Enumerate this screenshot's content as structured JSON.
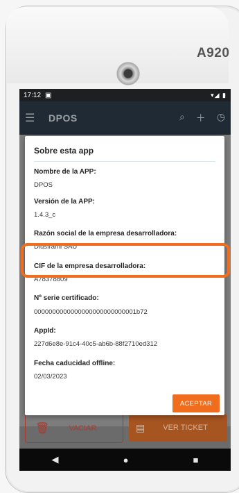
{
  "device": {
    "model": "A920"
  },
  "status_bar": {
    "time": "17:12",
    "icons": "▾◢ ▮"
  },
  "app_bar": {
    "title": "DPOS"
  },
  "dialog": {
    "title": "Sobre esta app",
    "fields": [
      {
        "label": "Nombre de la APP:",
        "value": "DPOS"
      },
      {
        "label": "Versión de la APP:",
        "value": "1.4.3_c"
      },
      {
        "label": "Razón social de la empresa desarrolladora:",
        "value": "Diusframi SAU"
      },
      {
        "label": "CIF de la empresa desarrolladora:",
        "value": "A78378809"
      },
      {
        "label": "Nº serie certificado:",
        "value": "0000000000000000000000000001b72"
      },
      {
        "label": "AppId:",
        "value": "227d6e8e-91c4-40c5-ab6b-88f2710ed312"
      },
      {
        "label": "Fecha caducidad offline:",
        "value": "02/03/2023"
      }
    ],
    "accept_label": "ACEPTAR"
  },
  "bottom_buttons": {
    "vaciar": "VACIAR",
    "ver_ticket": "VER TICKET"
  },
  "colors": {
    "accent": "#ef6d1d",
    "appbar": "#1f2a35"
  }
}
